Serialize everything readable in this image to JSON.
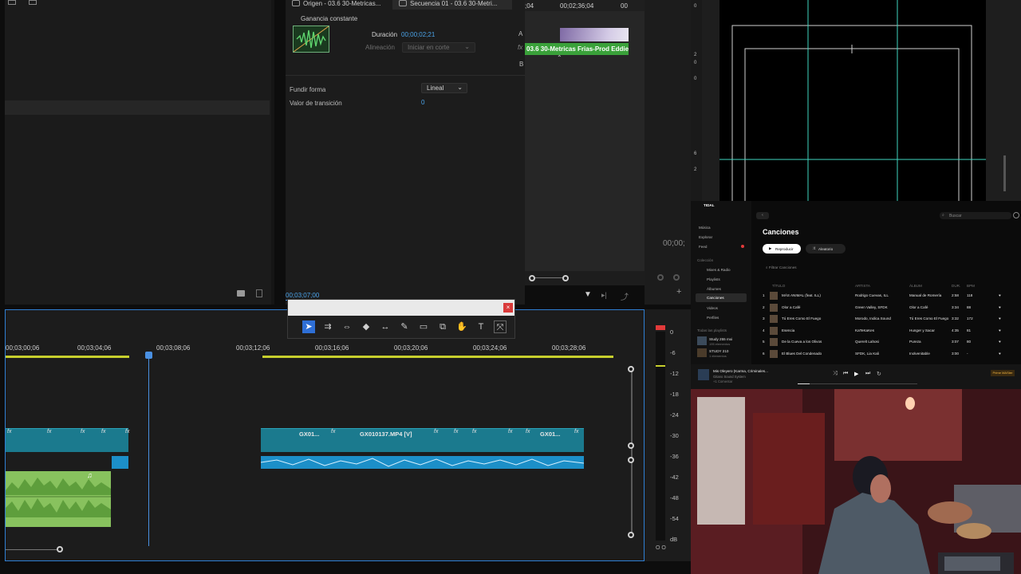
{
  "tabs": {
    "source": "Origen - 03.6 30-Metricas...",
    "sequence": "Secuencia 01 - 03.6 30-Metri..."
  },
  "effect": {
    "transition_name": "Ganancia constante",
    "duration_label": "Duración",
    "duration_value": "00;00;02;21",
    "alignment_label": "Alineación",
    "alignment_value": "Iniciar en corte",
    "a_label": "A",
    "b_label": "B",
    "fade_label": "Fundir forma",
    "fade_value": "Lineal",
    "trans_label": "Valor de transición",
    "trans_value": "0",
    "current_time": "00;03;07;00"
  },
  "mini_timeline": {
    "ruler_left": ";04",
    "ruler_mid": "00;02;36;04",
    "ruler_right": "00",
    "clip_label": "03.6 30-Metricas Frias-Prod Eddie E",
    "fx": "fx"
  },
  "program_monitor": {
    "timecode": "00;00;"
  },
  "timeline": {
    "ticks": [
      "00;03;00;06",
      "00;03;04;06",
      "00;03;08;06",
      "00;03;12;06",
      "00;03;16;06",
      "00;03;20;06",
      "00;03;24;06",
      "00;03;28;06"
    ],
    "clips": [
      "GX01...",
      "GX010137.MP4 [V]",
      "GX01..."
    ],
    "fx": "fx"
  },
  "vu_meter": {
    "scale": [
      "0",
      "-6",
      "-12",
      "-18",
      "-24",
      "-30",
      "-36",
      "-42",
      "-48",
      "-54",
      "dB"
    ],
    "footer": "O O"
  },
  "canvas": {
    "ruler": [
      "0",
      "2",
      "0",
      "0",
      "6",
      "2"
    ]
  },
  "music": {
    "app": "TIDAL",
    "search_placeholder": "Buscar",
    "nav": [
      "Música",
      "Explorar",
      "Feed"
    ],
    "collection_label": "Colección",
    "collection": [
      "Mixes & Radio",
      "Playlists",
      "Álbumes",
      "Canciones",
      "Videos",
      "Perfiles"
    ],
    "all_playlists": "Todas las playlists",
    "playlists": [
      {
        "name": "Study 255 mxi",
        "meta": "195 elementos"
      },
      {
        "name": "STUDY 210",
        "meta": "1 elementos"
      }
    ],
    "title": "Canciones",
    "play": "Reproducir",
    "shuffle": "Aleatorio",
    "filter": "Filtrar Canciones",
    "columns": [
      "TÍTULO",
      "ARTISTA",
      "ÁLBUM",
      "DUR.",
      "BPM"
    ],
    "tracks": [
      {
        "n": "1",
        "title": "MÁS ANIMAL (feat. ILL)",
        "artist": "Rodrigo Cuevas, ILL",
        "album": "Manual de Romería",
        "dur": "2:58",
        "bpm": "118"
      },
      {
        "n": "2",
        "title": "Olor a Café",
        "artist": "Green Valley, SFDK",
        "album": "Olor a Café",
        "dur": "3:34",
        "bpm": "88"
      },
      {
        "n": "3",
        "title": "Tú Eres Como El Fuego",
        "artist": "Morodo, Indica Sound",
        "album": "Tú Eres Como El Fuego",
        "dur": "3:32",
        "bpm": "172"
      },
      {
        "n": "4",
        "title": "Esencia",
        "artist": "KaTeKaKes",
        "album": "Hunger y Sacar",
        "dur": "4:35",
        "bpm": "81"
      },
      {
        "n": "5",
        "title": "De la Cueva a los Olivos",
        "artist": "Querelt Lahosi",
        "album": "Pureza",
        "dur": "3:07",
        "bpm": "80"
      },
      {
        "n": "6",
        "title": "El Blues Del Condenado",
        "artist": "SFDK, Lia Kali",
        "album": "Inolvenitable",
        "dur": "3:00",
        "bpm": "-"
      }
    ],
    "now_playing": {
      "title": "Mis Oleyero (Karma, Criminales...",
      "artist": "Gitano Sound System",
      "sub": "+1 Comentar",
      "badge": "Prime MASter"
    }
  },
  "colors": {
    "accent_blue": "#4a90e2",
    "clip_teal": "#1b7a8e",
    "audio_blue": "#1c8fc8",
    "audio_green": "#88c25e",
    "guide_teal": "#3fd6c0"
  }
}
